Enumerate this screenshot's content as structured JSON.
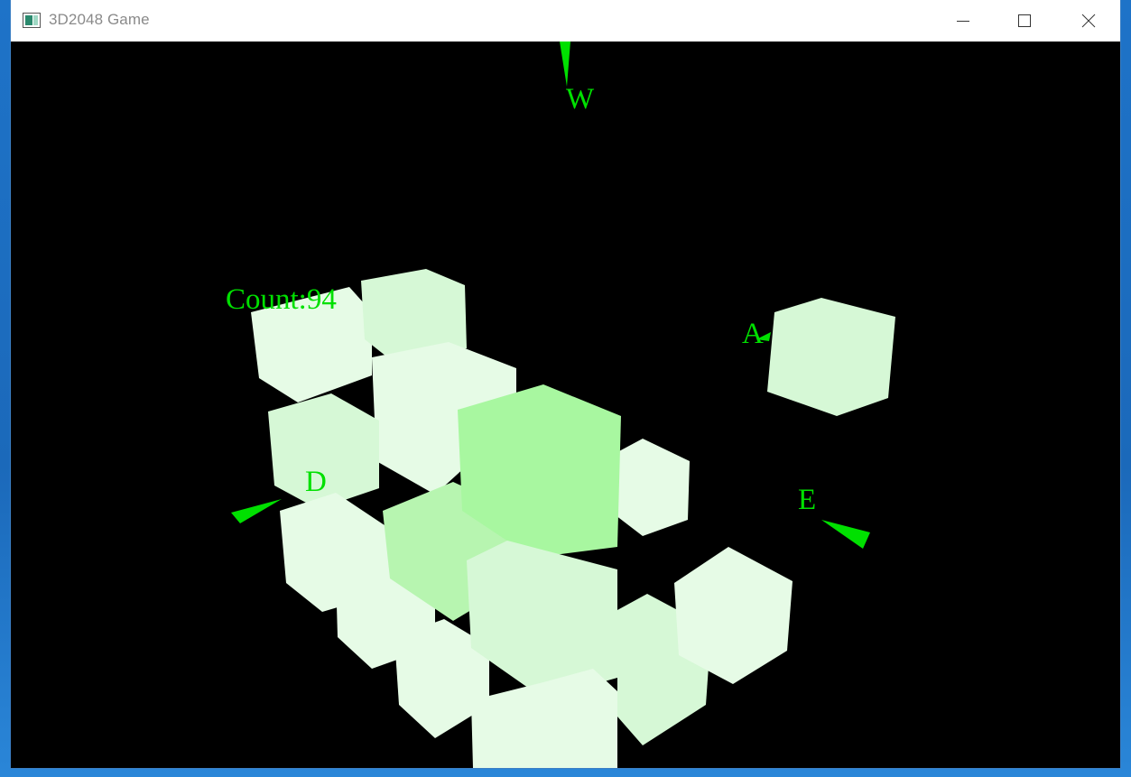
{
  "window": {
    "title": "3D2048 Game",
    "controls": {
      "minimize": "minimize-icon",
      "maximize": "maximize-icon",
      "close": "close-icon"
    }
  },
  "hud": {
    "count_text": "Count:94",
    "axis_labels": {
      "w": "W",
      "a": "A",
      "d": "D",
      "e": "E"
    },
    "accent_color": "#00e000"
  },
  "cube_colors": {
    "palest": "#e6fbe6",
    "pale": "#d6f8d6",
    "medium": "#b7f5b0",
    "strong": "#a8f7a0"
  }
}
